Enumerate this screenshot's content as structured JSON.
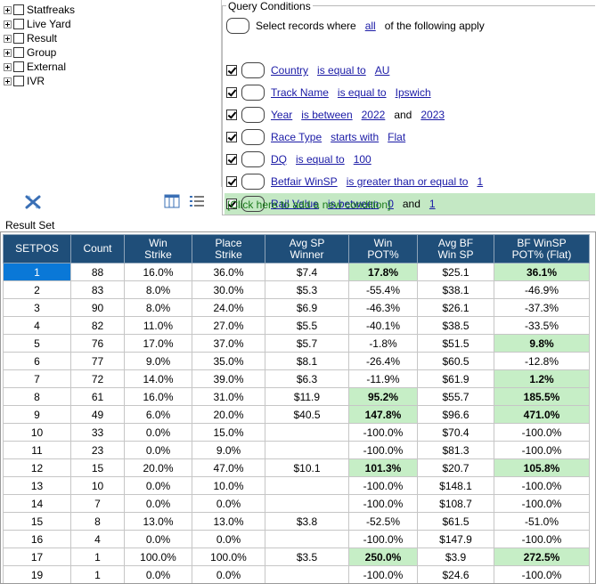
{
  "tree": {
    "items": [
      {
        "label": "Statfreaks"
      },
      {
        "label": "Live Yard"
      },
      {
        "label": "Result"
      },
      {
        "label": "Group"
      },
      {
        "label": "External"
      },
      {
        "label": "IVR"
      }
    ],
    "toolbar_icons": [
      "clear-icon",
      "columns-icon",
      "list-icon"
    ]
  },
  "query": {
    "title": "Query Conditions",
    "header": {
      "prefix": "Select records where",
      "mode": "all",
      "suffix": "of the following apply"
    },
    "conditions": [
      {
        "field": "Country",
        "op": "is equal to",
        "v1": "AU",
        "and": "",
        "v2": "",
        "checked": true,
        "selected": false
      },
      {
        "field": "Track Name",
        "op": "is equal to",
        "v1": "Ipswich",
        "and": "",
        "v2": "",
        "checked": true,
        "selected": false
      },
      {
        "field": "Year",
        "op": "is between",
        "v1": "2022",
        "and": "and",
        "v2": "2023",
        "checked": true,
        "selected": false
      },
      {
        "field": "Race Type",
        "op": "starts with",
        "v1": "Flat",
        "and": "",
        "v2": "",
        "checked": true,
        "selected": false
      },
      {
        "field": "DQ",
        "op": "is equal to",
        "v1": "100",
        "and": "",
        "v2": "",
        "checked": true,
        "selected": false
      },
      {
        "field": "Betfair WinSP",
        "op": "is greater than or equal to",
        "v1": "1",
        "and": "",
        "v2": "",
        "checked": true,
        "selected": false
      },
      {
        "field": "Rail Value",
        "op": "is between",
        "v1": "0",
        "and": "and",
        "v2": "1",
        "checked": true,
        "selected": true
      }
    ],
    "add_condition": "[Click here to add a new condition]"
  },
  "results": {
    "label": "Result Set",
    "columns": [
      [
        "SETPOS"
      ],
      [
        "Count"
      ],
      [
        "Win",
        "Strike"
      ],
      [
        "Place",
        "Strike"
      ],
      [
        "Avg SP",
        "Winner"
      ],
      [
        "Win",
        "POT%"
      ],
      [
        "Avg BF",
        "Win SP"
      ],
      [
        "BF WinSP",
        "POT% (Flat)"
      ]
    ],
    "rows": [
      [
        "1",
        "88",
        "16.0%",
        "36.0%",
        "$7.4",
        "17.8%",
        "$25.1",
        "36.1%"
      ],
      [
        "2",
        "83",
        "8.0%",
        "30.0%",
        "$5.3",
        "-55.4%",
        "$38.1",
        "-46.9%"
      ],
      [
        "3",
        "90",
        "8.0%",
        "24.0%",
        "$6.9",
        "-46.3%",
        "$26.1",
        "-37.3%"
      ],
      [
        "4",
        "82",
        "11.0%",
        "27.0%",
        "$5.5",
        "-40.1%",
        "$38.5",
        "-33.5%"
      ],
      [
        "5",
        "76",
        "17.0%",
        "37.0%",
        "$5.7",
        "-1.8%",
        "$51.5",
        "9.8%"
      ],
      [
        "6",
        "77",
        "9.0%",
        "35.0%",
        "$8.1",
        "-26.4%",
        "$60.5",
        "-12.8%"
      ],
      [
        "7",
        "72",
        "14.0%",
        "39.0%",
        "$6.3",
        "-11.9%",
        "$61.9",
        "1.2%"
      ],
      [
        "8",
        "61",
        "16.0%",
        "31.0%",
        "$11.9",
        "95.2%",
        "$55.7",
        "185.5%"
      ],
      [
        "9",
        "49",
        "6.0%",
        "20.0%",
        "$40.5",
        "147.8%",
        "$96.6",
        "471.0%"
      ],
      [
        "10",
        "33",
        "0.0%",
        "15.0%",
        "",
        "-100.0%",
        "$70.4",
        "-100.0%"
      ],
      [
        "11",
        "23",
        "0.0%",
        "9.0%",
        "",
        "-100.0%",
        "$81.3",
        "-100.0%"
      ],
      [
        "12",
        "15",
        "20.0%",
        "47.0%",
        "$10.1",
        "101.3%",
        "$20.7",
        "105.8%"
      ],
      [
        "13",
        "10",
        "0.0%",
        "10.0%",
        "",
        "-100.0%",
        "$148.1",
        "-100.0%"
      ],
      [
        "14",
        "7",
        "0.0%",
        "0.0%",
        "",
        "-100.0%",
        "$108.7",
        "-100.0%"
      ],
      [
        "15",
        "8",
        "13.0%",
        "13.0%",
        "$3.8",
        "-52.5%",
        "$61.5",
        "-51.0%"
      ],
      [
        "16",
        "4",
        "0.0%",
        "0.0%",
        "",
        "-100.0%",
        "$147.9",
        "-100.0%"
      ],
      [
        "17",
        "1",
        "100.0%",
        "100.0%",
        "$3.5",
        "250.0%",
        "$3.9",
        "272.5%"
      ],
      [
        "19",
        "1",
        "0.0%",
        "0.0%",
        "",
        "-100.0%",
        "$24.6",
        "-100.0%"
      ]
    ],
    "selected_row": 0,
    "colors": {
      "header": "#1f4e79",
      "positive": "#c6eec6",
      "selected": "#0a78d7"
    }
  }
}
